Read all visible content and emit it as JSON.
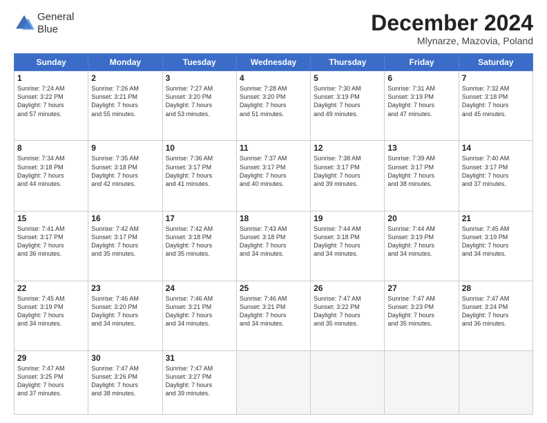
{
  "header": {
    "logo_line1": "General",
    "logo_line2": "Blue",
    "month": "December 2024",
    "location": "Mlynarze, Mazovia, Poland"
  },
  "weekdays": [
    "Sunday",
    "Monday",
    "Tuesday",
    "Wednesday",
    "Thursday",
    "Friday",
    "Saturday"
  ],
  "weeks": [
    [
      {
        "day": "1",
        "text": "Sunrise: 7:24 AM\nSunset: 3:22 PM\nDaylight: 7 hours\nand 57 minutes."
      },
      {
        "day": "2",
        "text": "Sunrise: 7:26 AM\nSunset: 3:21 PM\nDaylight: 7 hours\nand 55 minutes."
      },
      {
        "day": "3",
        "text": "Sunrise: 7:27 AM\nSunset: 3:20 PM\nDaylight: 7 hours\nand 53 minutes."
      },
      {
        "day": "4",
        "text": "Sunrise: 7:28 AM\nSunset: 3:20 PM\nDaylight: 7 hours\nand 51 minutes."
      },
      {
        "day": "5",
        "text": "Sunrise: 7:30 AM\nSunset: 3:19 PM\nDaylight: 7 hours\nand 49 minutes."
      },
      {
        "day": "6",
        "text": "Sunrise: 7:31 AM\nSunset: 3:19 PM\nDaylight: 7 hours\nand 47 minutes."
      },
      {
        "day": "7",
        "text": "Sunrise: 7:32 AM\nSunset: 3:18 PM\nDaylight: 7 hours\nand 45 minutes."
      }
    ],
    [
      {
        "day": "8",
        "text": "Sunrise: 7:34 AM\nSunset: 3:18 PM\nDaylight: 7 hours\nand 44 minutes."
      },
      {
        "day": "9",
        "text": "Sunrise: 7:35 AM\nSunset: 3:18 PM\nDaylight: 7 hours\nand 42 minutes."
      },
      {
        "day": "10",
        "text": "Sunrise: 7:36 AM\nSunset: 3:17 PM\nDaylight: 7 hours\nand 41 minutes."
      },
      {
        "day": "11",
        "text": "Sunrise: 7:37 AM\nSunset: 3:17 PM\nDaylight: 7 hours\nand 40 minutes."
      },
      {
        "day": "12",
        "text": "Sunrise: 7:38 AM\nSunset: 3:17 PM\nDaylight: 7 hours\nand 39 minutes."
      },
      {
        "day": "13",
        "text": "Sunrise: 7:39 AM\nSunset: 3:17 PM\nDaylight: 7 hours\nand 38 minutes."
      },
      {
        "day": "14",
        "text": "Sunrise: 7:40 AM\nSunset: 3:17 PM\nDaylight: 7 hours\nand 37 minutes."
      }
    ],
    [
      {
        "day": "15",
        "text": "Sunrise: 7:41 AM\nSunset: 3:17 PM\nDaylight: 7 hours\nand 36 minutes."
      },
      {
        "day": "16",
        "text": "Sunrise: 7:42 AM\nSunset: 3:17 PM\nDaylight: 7 hours\nand 35 minutes."
      },
      {
        "day": "17",
        "text": "Sunrise: 7:42 AM\nSunset: 3:18 PM\nDaylight: 7 hours\nand 35 minutes."
      },
      {
        "day": "18",
        "text": "Sunrise: 7:43 AM\nSunset: 3:18 PM\nDaylight: 7 hours\nand 34 minutes."
      },
      {
        "day": "19",
        "text": "Sunrise: 7:44 AM\nSunset: 3:18 PM\nDaylight: 7 hours\nand 34 minutes."
      },
      {
        "day": "20",
        "text": "Sunrise: 7:44 AM\nSunset: 3:19 PM\nDaylight: 7 hours\nand 34 minutes."
      },
      {
        "day": "21",
        "text": "Sunrise: 7:45 AM\nSunset: 3:19 PM\nDaylight: 7 hours\nand 34 minutes."
      }
    ],
    [
      {
        "day": "22",
        "text": "Sunrise: 7:45 AM\nSunset: 3:19 PM\nDaylight: 7 hours\nand 34 minutes."
      },
      {
        "day": "23",
        "text": "Sunrise: 7:46 AM\nSunset: 3:20 PM\nDaylight: 7 hours\nand 34 minutes."
      },
      {
        "day": "24",
        "text": "Sunrise: 7:46 AM\nSunset: 3:21 PM\nDaylight: 7 hours\nand 34 minutes."
      },
      {
        "day": "25",
        "text": "Sunrise: 7:46 AM\nSunset: 3:21 PM\nDaylight: 7 hours\nand 34 minutes."
      },
      {
        "day": "26",
        "text": "Sunrise: 7:47 AM\nSunset: 3:22 PM\nDaylight: 7 hours\nand 35 minutes."
      },
      {
        "day": "27",
        "text": "Sunrise: 7:47 AM\nSunset: 3:23 PM\nDaylight: 7 hours\nand 35 minutes."
      },
      {
        "day": "28",
        "text": "Sunrise: 7:47 AM\nSunset: 3:24 PM\nDaylight: 7 hours\nand 36 minutes."
      }
    ],
    [
      {
        "day": "29",
        "text": "Sunrise: 7:47 AM\nSunset: 3:25 PM\nDaylight: 7 hours\nand 37 minutes."
      },
      {
        "day": "30",
        "text": "Sunrise: 7:47 AM\nSunset: 3:26 PM\nDaylight: 7 hours\nand 38 minutes."
      },
      {
        "day": "31",
        "text": "Sunrise: 7:47 AM\nSunset: 3:27 PM\nDaylight: 7 hours\nand 39 minutes."
      },
      null,
      null,
      null,
      null
    ]
  ]
}
